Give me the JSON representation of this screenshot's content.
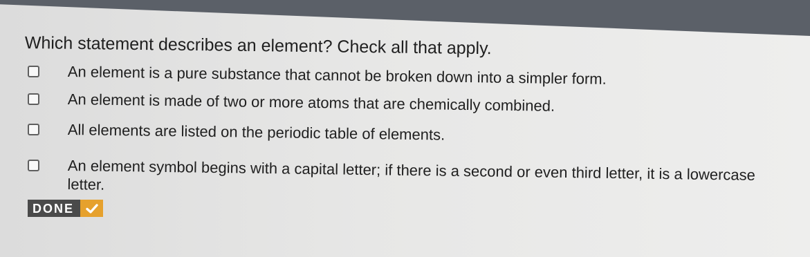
{
  "colors": {
    "header_bar": "#5b6068",
    "text": "#1f1f1f",
    "done_background": "#4a4a4a",
    "done_accent": "#e6a12d"
  },
  "question": {
    "text": "Which statement describes an element? Check all that apply."
  },
  "options": [
    {
      "label": "An element is a pure substance that cannot be broken down into a simpler form.",
      "checked": false
    },
    {
      "label": "An element is made of two or more atoms that are chemically combined.",
      "checked": false
    },
    {
      "label": "All elements are listed on the periodic table of elements.",
      "checked": false
    },
    {
      "label": "An element symbol begins with a capital letter; if there is a second or even third letter, it is a lowercase letter.",
      "checked": false
    }
  ],
  "done_button": {
    "label": "DONE",
    "icon": "checkmark-icon"
  }
}
